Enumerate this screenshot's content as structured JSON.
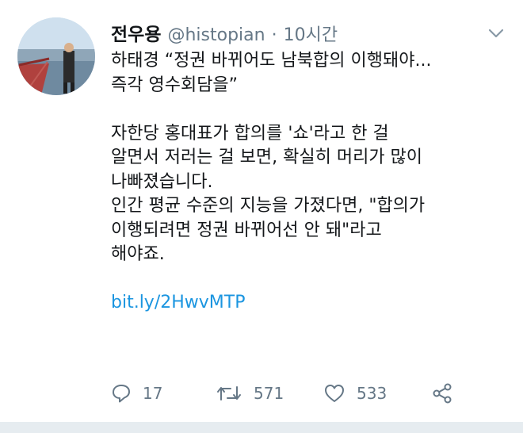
{
  "tweet": {
    "author_name": "전우용",
    "handle": "@histopian",
    "separator": "·",
    "time": "10시간",
    "lines": [
      "하태경 “정권 바뀌어도 남북합의 이행돼야...",
      "즉각 영수회담을”",
      "",
      "자한당 홍대표가 합의를 '쇼'라고 한 걸",
      "알면서 저러는 걸 보면, 확실히 머리가 많이",
      "나빠졌습니다.",
      "인간 평균 수준의 지능을 가졌다면, \"합의가",
      "이행되려면 정권 바뀌어선 안 돼\"라고",
      "해야죠.",
      ""
    ],
    "link_text": "bit.ly/2HwvMTP"
  },
  "actions": {
    "reply_count": "17",
    "retweet_count": "571",
    "like_count": "533"
  },
  "icons": {
    "caret": "chevron-down-icon",
    "reply": "reply-icon",
    "retweet": "retweet-icon",
    "like": "heart-icon",
    "share": "share-icon"
  },
  "colors": {
    "text": "#14171a",
    "secondary": "#657786",
    "link": "#1b95e0"
  }
}
